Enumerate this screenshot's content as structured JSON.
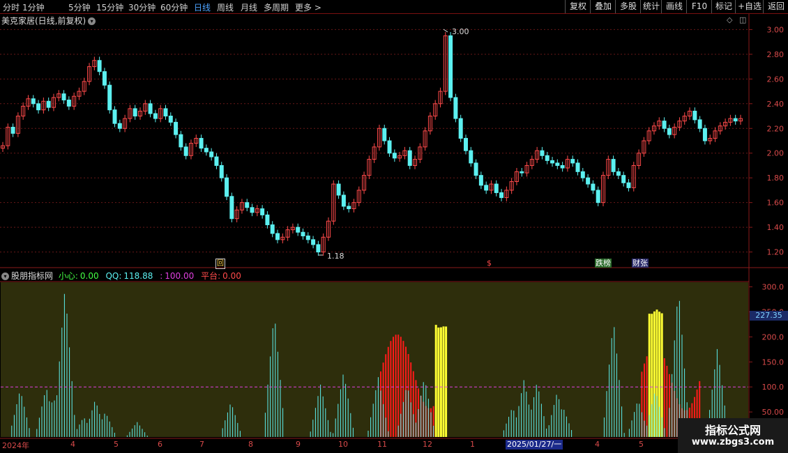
{
  "toolbar": {
    "periods": [
      "分时",
      "1分钟",
      "5分钟",
      "15分钟",
      "30分钟",
      "60分钟",
      "日线",
      "周线",
      "月线",
      "多周期",
      "更多 >"
    ],
    "active_period": "日线",
    "buttons": [
      "复权",
      "叠加",
      "多股",
      "统计",
      "画线",
      "F10",
      "标记",
      "+自选",
      "返回"
    ]
  },
  "price_panel": {
    "title": "美克家居(日线,前复权)",
    "y_ticks": [
      "3.00",
      "2.80",
      "2.60",
      "2.40",
      "2.20",
      "2.00",
      "1.80",
      "1.60",
      "1.40",
      "1.20"
    ],
    "high_label": "3.00",
    "low_label": "1.18",
    "markers": [
      "回",
      "$",
      "跌榜",
      "财张"
    ]
  },
  "indicator_panel": {
    "name": "股朋指标网",
    "xiaoxin_label": "小心:",
    "xiaoxin_value": "0.00",
    "qq_label": "QQ:",
    "qq_value": "118.88",
    "third_label": ":",
    "third_value": "100.00",
    "pingtai_label": "平台:",
    "pingtai_value": "0.00",
    "y_ticks": [
      "300.0",
      "250.0",
      "200.0",
      "150.0",
      "100.0",
      "50.00"
    ],
    "current_value": "227.35"
  },
  "x_axis": {
    "labels": [
      "2024年",
      "4",
      "5",
      "6",
      "7",
      "8",
      "9",
      "10",
      "11",
      "12",
      "1",
      "4",
      "5"
    ],
    "current_date": "2025/01/27/一"
  },
  "watermark": {
    "line1": "指标公式网",
    "line2": "www.zbgs3.com"
  },
  "colors": {
    "up": "#ff4a4a",
    "down": "#5cf0f0",
    "indicator_bg": "#2e2e0c",
    "yellow": "#ffff33",
    "grid": "#6a1818"
  },
  "chart_data": {
    "type": "candlestick",
    "price_ylim": [
      1.13,
      3.07
    ],
    "closes": [
      2.06,
      2.21,
      2.16,
      2.3,
      2.38,
      2.44,
      2.4,
      2.35,
      2.42,
      2.37,
      2.45,
      2.48,
      2.43,
      2.38,
      2.46,
      2.5,
      2.58,
      2.7,
      2.75,
      2.66,
      2.55,
      2.35,
      2.24,
      2.2,
      2.28,
      2.36,
      2.3,
      2.34,
      2.4,
      2.32,
      2.28,
      2.36,
      2.3,
      2.25,
      2.15,
      2.05,
      1.98,
      2.08,
      2.12,
      2.04,
      2.01,
      1.97,
      1.9,
      1.8,
      1.65,
      1.47,
      1.54,
      1.6,
      1.56,
      1.52,
      1.55,
      1.5,
      1.42,
      1.35,
      1.3,
      1.32,
      1.38,
      1.4,
      1.36,
      1.33,
      1.3,
      1.26,
      1.2,
      1.32,
      1.45,
      1.75,
      1.66,
      1.57,
      1.55,
      1.6,
      1.7,
      1.82,
      1.95,
      2.05,
      2.2,
      2.1,
      2.0,
      1.96,
      1.98,
      2.02,
      1.9,
      1.95,
      2.05,
      2.18,
      2.3,
      2.4,
      2.5,
      2.95,
      2.45,
      2.28,
      2.12,
      2.02,
      1.92,
      1.82,
      1.74,
      1.7,
      1.75,
      1.68,
      1.64,
      1.7,
      1.77,
      1.85,
      1.84,
      1.9,
      1.95,
      2.02,
      1.98,
      1.94,
      1.92,
      1.9,
      1.88,
      1.95,
      1.92,
      1.85,
      1.8,
      1.75,
      1.7,
      1.6,
      1.82,
      1.95,
      1.85,
      1.82,
      1.76,
      1.72,
      1.9,
      2.0,
      2.1,
      2.18,
      2.22,
      2.26,
      2.2,
      2.15,
      2.21,
      2.26,
      2.3,
      2.34,
      2.27,
      2.2,
      2.1,
      2.12,
      2.18,
      2.22,
      2.25,
      2.28,
      2.26,
      2.28
    ],
    "ind_ylim": [
      0,
      305
    ],
    "cyan_line": [
      25,
      60,
      75,
      90,
      70,
      40,
      20,
      8,
      0,
      0,
      0,
      0,
      5,
      30,
      80,
      110,
      95,
      60,
      20,
      0,
      0,
      0,
      0,
      10,
      50,
      150,
      300,
      250,
      190,
      120,
      60,
      20,
      0,
      0,
      0,
      0,
      0,
      0,
      0,
      0,
      0,
      0,
      0,
      0,
      0,
      0,
      0,
      0,
      0,
      0,
      0,
      0,
      0,
      0,
      0,
      0,
      0,
      40,
      45,
      50,
      30,
      0,
      0,
      0,
      0,
      0,
      0,
      0,
      0,
      0,
      0,
      0,
      0,
      0,
      0,
      0,
      0,
      0,
      0,
      0,
      0,
      0,
      0,
      0,
      0,
      0,
      0,
      0,
      0,
      0,
      0,
      0,
      0,
      0,
      0,
      0,
      0,
      0,
      0,
      0,
      0,
      0,
      0,
      0,
      0,
      0,
      0,
      0,
      0,
      0,
      0,
      0,
      0,
      0,
      0,
      0,
      0,
      0,
      0,
      0,
      0,
      0,
      0,
      0,
      0,
      0,
      0,
      0,
      0,
      0,
      0,
      0,
      0,
      0,
      0,
      0,
      0,
      0,
      0,
      0,
      0,
      0
    ],
    "red_bars": [
      0,
      0,
      0,
      0,
      0,
      0,
      0,
      0,
      0,
      0,
      0,
      0,
      0,
      0,
      0,
      0,
      0,
      0,
      0,
      0,
      0,
      0,
      0,
      0,
      0,
      0,
      0,
      0,
      0,
      0,
      0,
      0,
      0,
      0,
      0,
      0,
      0,
      0,
      0,
      0,
      0,
      0,
      0,
      0,
      0,
      0,
      0,
      0,
      0,
      0,
      0,
      0,
      0,
      0,
      0,
      0,
      0,
      0,
      0,
      0,
      0,
      0,
      0,
      0,
      0,
      0,
      0,
      0,
      0,
      0,
      0,
      0,
      0,
      0,
      0,
      0,
      0,
      0,
      0,
      0,
      0,
      0,
      0,
      0,
      0,
      0,
      0,
      0,
      0,
      0,
      0,
      0,
      0,
      0,
      0,
      0,
      0,
      0,
      0,
      0,
      0,
      0,
      0,
      0,
      0,
      0,
      0,
      0,
      0,
      0,
      0,
      0,
      0,
      0,
      0,
      0,
      0,
      0,
      0,
      0,
      0,
      0,
      0,
      0,
      0,
      0,
      0,
      0,
      0,
      0,
      0,
      0,
      0,
      0,
      0,
      0,
      0,
      0,
      0,
      0,
      0,
      0,
      0,
      0,
      0,
      0
    ],
    "yellow_bars": [],
    "reference_line": 100
  }
}
